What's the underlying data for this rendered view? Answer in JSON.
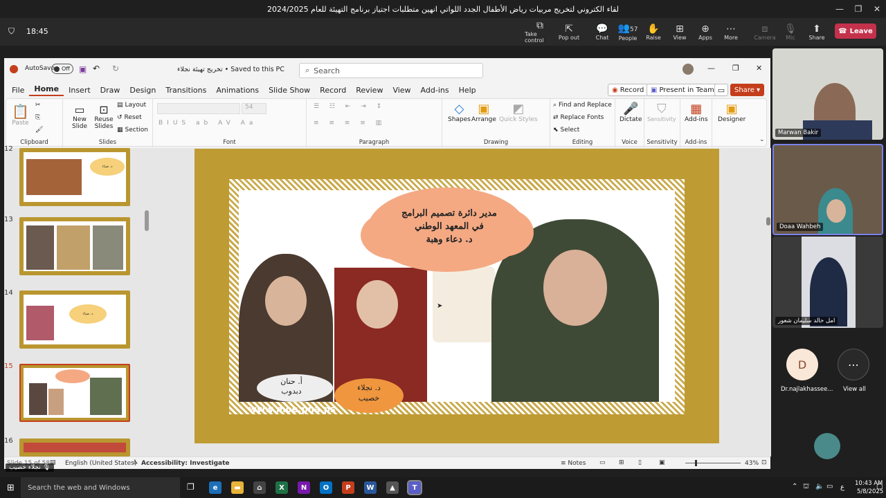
{
  "teams": {
    "window_title": "لقاء الكتروني لتخريج مربيات رياض الأطفال الجدد اللواتي انهين متطلبات اجتياز برنامج التهيئة للعام 2024/2025",
    "timer": "18:45",
    "buttons": {
      "take_control": "Take control",
      "pop_out": "Pop out",
      "chat": "Chat",
      "people": "People",
      "people_count": "57",
      "raise": "Raise",
      "view": "View",
      "apps": "Apps",
      "more": "More",
      "camera": "Camera",
      "mic": "Mic",
      "share": "Share",
      "leave": "Leave"
    }
  },
  "ppt": {
    "autosave_label": "AutoSave",
    "autosave_state": "Off",
    "doc_title": "تخريج تهيئة نجلاء • Saved to this PC",
    "search_placeholder": "Search",
    "menu": [
      "File",
      "Home",
      "Insert",
      "Draw",
      "Design",
      "Transitions",
      "Animations",
      "Slide Show",
      "Record",
      "Review",
      "View",
      "Add-ins",
      "Help"
    ],
    "record_btn": "Record",
    "present_btn": "Present in Teams",
    "share_btn": "Share",
    "ribbon": {
      "clipboard": {
        "label": "Clipboard",
        "paste": "Paste"
      },
      "slides": {
        "label": "Slides",
        "new_slide": "New Slide",
        "reuse_slides": "Reuse Slides",
        "layout": "Layout",
        "reset": "Reset",
        "section": "Section"
      },
      "font": {
        "label": "Font",
        "size": "54"
      },
      "paragraph": {
        "label": "Paragraph"
      },
      "drawing": {
        "label": "Drawing",
        "shapes": "Shapes",
        "arrange": "Arrange",
        "quick_styles": "Quick Styles"
      },
      "editing": {
        "label": "Editing",
        "find_replace": "Find and Replace",
        "replace_fonts": "Replace Fonts",
        "select": "Select"
      },
      "voice": {
        "label": "Voice",
        "dictate": "Dictate"
      },
      "sensitivity": {
        "label": "Sensitivity",
        "btn": "Sensitivity"
      },
      "addins": {
        "label": "Add-ins",
        "btn": "Add-ins"
      },
      "designer": {
        "btn": "Designer"
      }
    },
    "thumbnails": [
      {
        "num": "12",
        "caption": "د. ضياء"
      },
      {
        "num": "13",
        "caption": ""
      },
      {
        "num": "14",
        "caption": "د. ضياء"
      },
      {
        "num": "15",
        "caption": ""
      },
      {
        "num": "16",
        "caption": ""
      }
    ],
    "slide": {
      "cloud_main_line1": "مدير دائرة تصميم البرامج",
      "cloud_main_line2": "في المعهد الوطني",
      "cloud_main_line3": "د. دعاء وهبة",
      "cloud_left": "أ. حنان دبدوب",
      "cloud_mid": "د. نجلاء خصيب",
      "watermark": "www.moe.pna.ps"
    },
    "status": {
      "slide_of": "Slide 15 of 58",
      "language": "English (United States)",
      "accessibility": "Accessibility: Investigate",
      "notes": "Notes",
      "zoom": "43%"
    },
    "presenter_badge": "نجلاء خصيب"
  },
  "participants": [
    {
      "name": "Marwan Bakir"
    },
    {
      "name": "Doaa Wahbeh"
    },
    {
      "name": "امل خالد سليمان شعور"
    },
    {
      "name": "Dr.najlakhassee...",
      "initial": "D"
    },
    {
      "name": "View all"
    }
  ],
  "taskbar": {
    "search": "Search the web and Windows",
    "time": "10:43 AM",
    "date": "5/8/2025",
    "lang": "ع"
  },
  "colors": {
    "slide_gold": "#bf9b33",
    "cloud_orange": "#f4a983",
    "leave_red": "#c4314b",
    "ppt_accent": "#c43e1c"
  }
}
